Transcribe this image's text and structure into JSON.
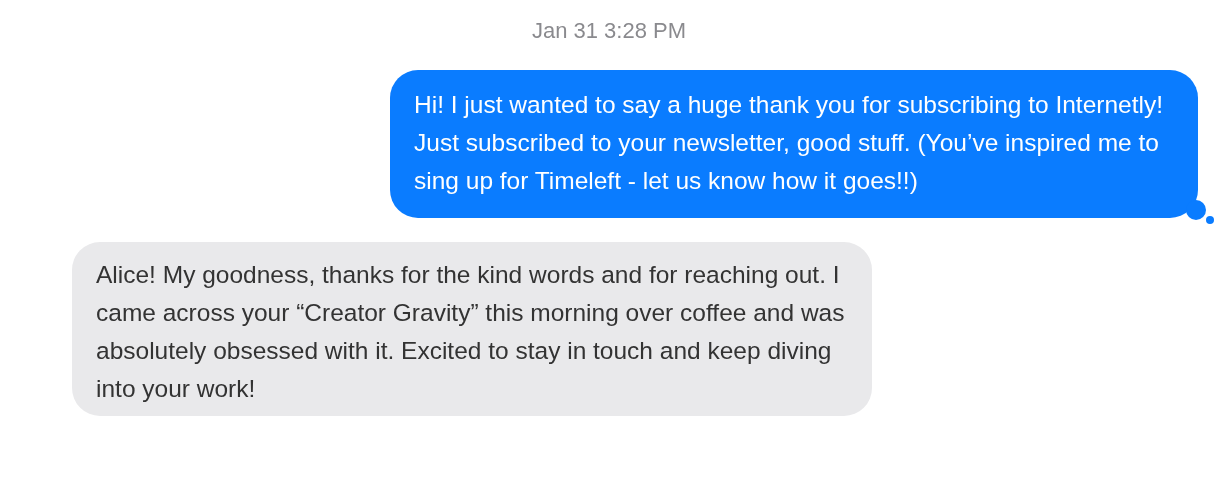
{
  "timestamp": "Jan 31 3:28 PM",
  "messages": [
    {
      "kind": "sent",
      "text": "Hi! I just wanted to say a huge thank you for subscribing to Internetly! Just subscribed to your newsletter, good stuff. (You’ve inspired me to sing up for Timeleft - let us know how it goes!!)"
    },
    {
      "kind": "received",
      "text": "Alice! My goodness, thanks for the kind words and for reaching out. I came across your “Creator Gravity” this morning over coffee and was absolutely obsessed with it. Excited to stay in touch and keep diving into your work!"
    }
  ]
}
